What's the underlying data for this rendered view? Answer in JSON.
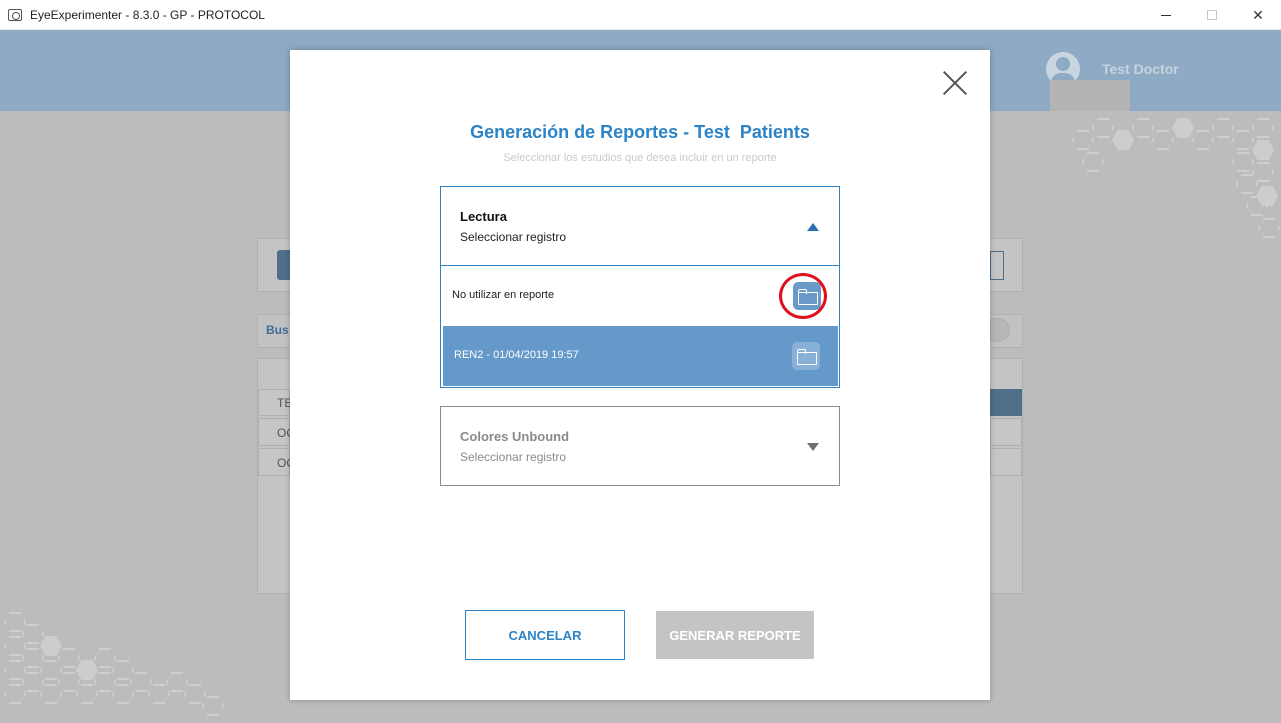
{
  "window": {
    "title": "EyeExperimenter - 8.3.0 - GP - PROTOCOL",
    "minimize": "",
    "maximize": "",
    "close": "✕"
  },
  "header": {
    "user_name": "Test Doctor"
  },
  "background": {
    "search_label": "Bus",
    "rows": [
      "TE",
      "OC",
      "OC"
    ]
  },
  "modal": {
    "title": "Generación de Reportes - Test  Patients",
    "subtitle": "Seleccionar los estudios que desea incluir en un reporte",
    "sections": [
      {
        "name": "Lectura",
        "hint": "Seleccionar registro",
        "expanded": true,
        "options": [
          {
            "label": "No utilizar en reporte",
            "selected": false
          },
          {
            "label": "REN2 - 01/04/2019 19:57",
            "selected": true
          }
        ]
      },
      {
        "name": "Colores Unbound",
        "hint": "Seleccionar registro",
        "expanded": false
      }
    ],
    "cancel_label": "CANCELAR",
    "generate_label": "GENERAR REPORTE"
  },
  "colors": {
    "accent": "#2c83c6",
    "selected_row": "#6499c9",
    "highlight_ring": "#e0101e",
    "header_bg": "#8eaac4"
  }
}
